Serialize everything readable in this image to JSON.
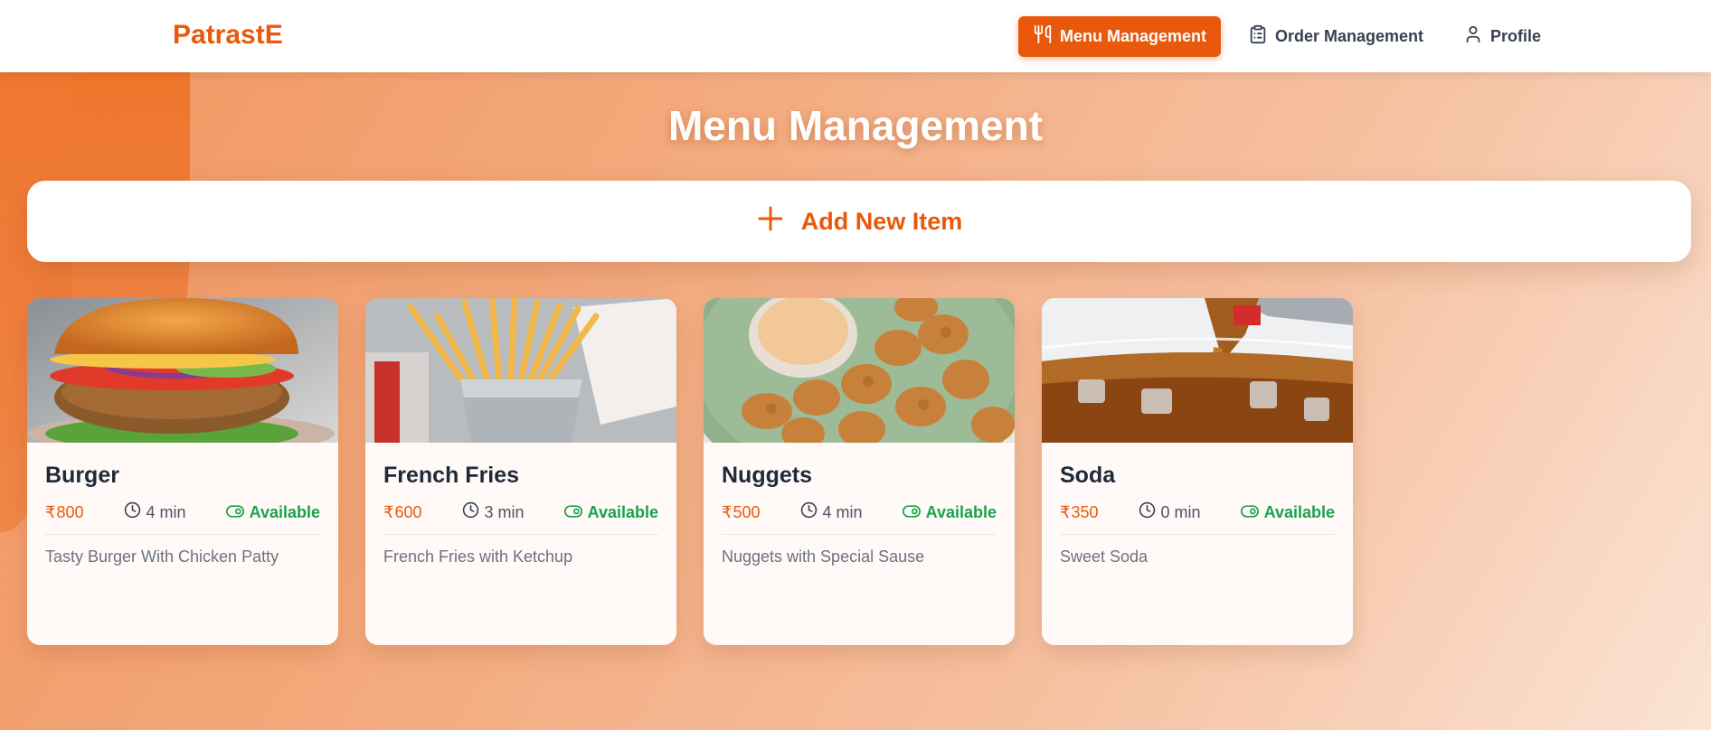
{
  "brand": "PatrastE",
  "nav": {
    "menu_management": "Menu Management",
    "order_management": "Order Management",
    "profile": "Profile"
  },
  "page_title": "Menu Management",
  "add_button": "Add New Item",
  "items": [
    {
      "name": "Burger",
      "price": "800",
      "time": "4 min",
      "status": "Available",
      "description": "Tasty Burger With Chicken Patty"
    },
    {
      "name": "French Fries",
      "price": "600",
      "time": "3 min",
      "status": "Available",
      "description": "French Fries with Ketchup"
    },
    {
      "name": "Nuggets",
      "price": "500",
      "time": "4 min",
      "status": "Available",
      "description": "Nuggets with Special Sause"
    },
    {
      "name": "Soda",
      "price": "350",
      "time": "0 min",
      "status": "Available",
      "description": "Sweet Soda"
    }
  ],
  "currency_symbol": "₹",
  "colors": {
    "accent": "#ea580c",
    "available": "#16a34a"
  }
}
